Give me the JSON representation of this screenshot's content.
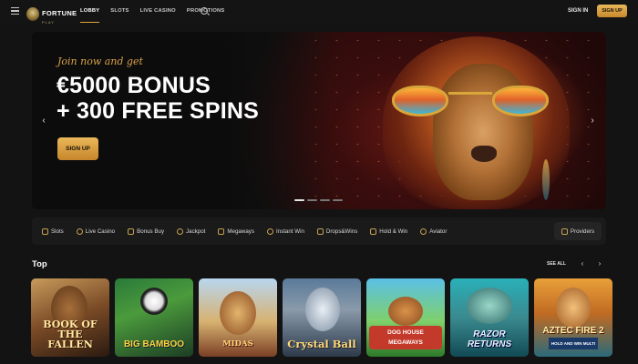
{
  "header": {
    "logo_text": "FORTUNE",
    "logo_sub": "PLAY",
    "nav": [
      "LOBBY",
      "SLOTS",
      "LIVE CASINO",
      "PROMOTIONS"
    ],
    "active_nav": "LOBBY",
    "signin": "SIGN IN",
    "signup": "SIGN UP"
  },
  "hero": {
    "eyebrow": "Join now and get",
    "title_line1": "€5000 BONUS",
    "title_line2": "+ 300 FREE SPINS",
    "cta": "SIGN UP",
    "slides": 4,
    "active_slide": 0
  },
  "categories": {
    "items": [
      "Slots",
      "Live Casino",
      "Bonus Buy",
      "Jackpot",
      "Megaways",
      "Instant Win",
      "Drops&Wins",
      "Hold & Win",
      "Aviator"
    ],
    "providers": "Providers"
  },
  "top_section": {
    "title": "Top",
    "see_all": "SEE ALL",
    "games": [
      {
        "label": "BOOK OF THE FALLEN"
      },
      {
        "label": "BIG BAMBOO"
      },
      {
        "label": "MIDAS"
      },
      {
        "label": "Crystal Ball"
      },
      {
        "label": "DOG HOUSE MEGAWAYS"
      },
      {
        "label": "RAZOR RETURNS"
      },
      {
        "label": "AZTEC FIRE 2",
        "sub": "HOLD AND WIN MULTI"
      }
    ]
  },
  "colors": {
    "accent_gold": "#e3a83a",
    "background": "#131313"
  }
}
